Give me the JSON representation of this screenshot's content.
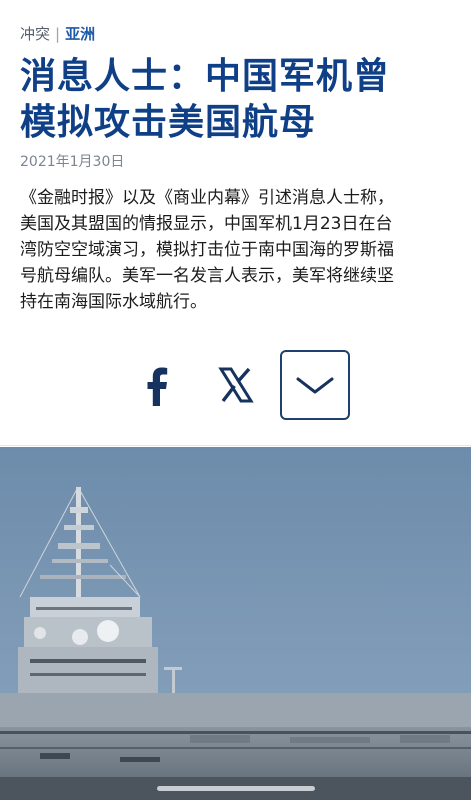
{
  "breadcrumb": {
    "section": "冲突",
    "separator": "|",
    "region": "亚洲"
  },
  "headline": {
    "line1": "消息人士：中国军机曾",
    "line2": "模拟攻击美国航母"
  },
  "date": "2021年1月30日",
  "body": {
    "line1": "《金融时报》以及《商业内幕》引述消息人士称，",
    "line2": "美国及其盟国的情报显示，中国军机1月23日在台",
    "line3": "湾防空空域演习，模拟打击位于南中国海的罗斯福",
    "line4": "号航母编队。美军一名发言人表示，美军将继续坚",
    "line5": "持在南海国际水域航行。"
  },
  "share": {
    "facebook_icon": "facebook-icon",
    "x_icon": "x-icon",
    "more_icon": "chevron-down-icon"
  },
  "photo": {
    "subject": "aircraft-carrier"
  },
  "colors": {
    "headline": "#0f3f86",
    "accent": "#1f5aa6",
    "sky": "#6f8fae",
    "ship": "#9aa6b2"
  }
}
